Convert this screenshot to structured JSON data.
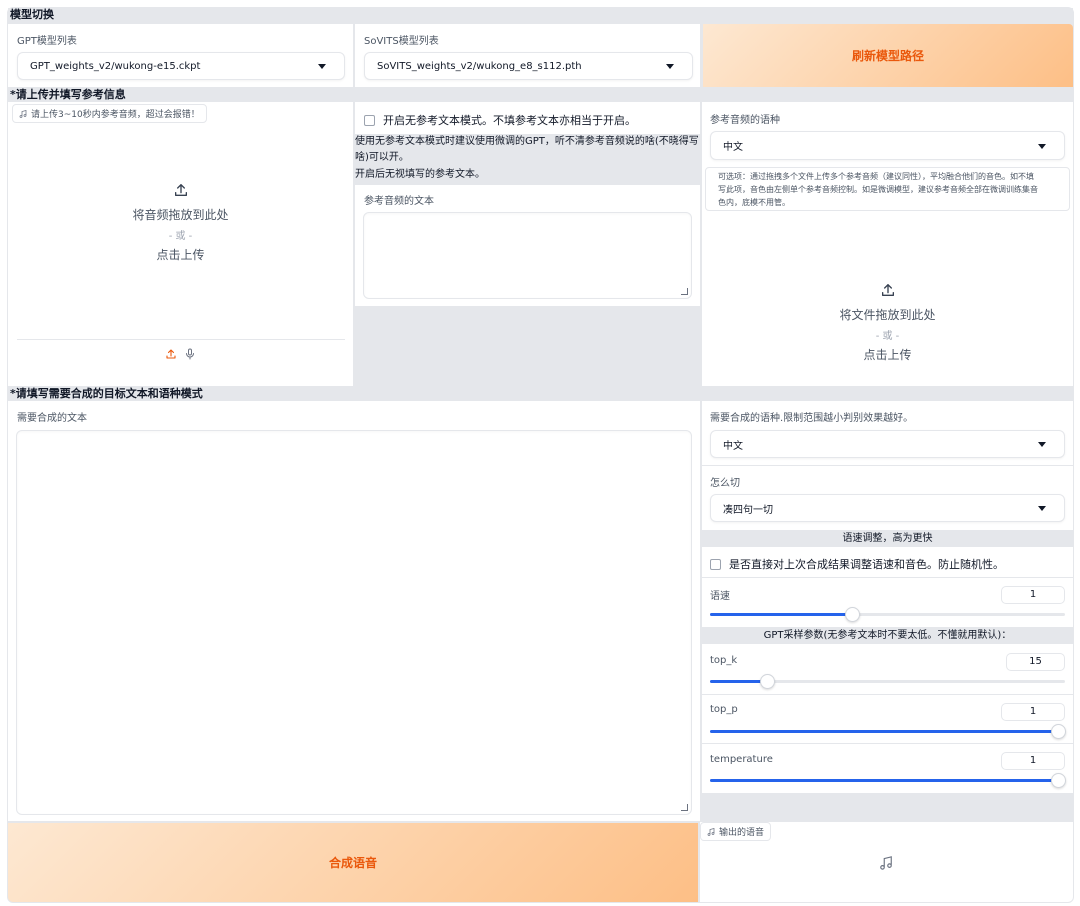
{
  "sections": {
    "model_switch": "模型切换",
    "reference": "*请上传并填写参考信息",
    "target": "*请填写需要合成的目标文本和语种模式"
  },
  "gpt_model": {
    "label": "GPT模型列表",
    "value": "GPT_weights_v2/wukong-e15.ckpt"
  },
  "sovits_model": {
    "label": "SoVITS模型列表",
    "value": "SoVITS_weights_v2/wukong_e8_s112.pth"
  },
  "refresh_button": "刷新模型路径",
  "ref_audio": {
    "chip": "请上传3~10秒内参考音频，超过会报错！",
    "drop_text": "将音频拖放到此处",
    "or_text": "- 或 -",
    "click_text": "点击上传"
  },
  "no_ref": {
    "checkbox_label": "开启无参考文本模式。不填参考文本亦相当于开启。",
    "info_line1": "使用无参考文本模式时建议使用微调的GPT，听不清参考音频说的啥(不晓得写",
    "info_line2": "啥)可以开。",
    "info_line3": "开启后无视填写的参考文本。"
  },
  "ref_text": {
    "label": "参考音频的文本",
    "value": ""
  },
  "ref_lang": {
    "label": "参考音频的语种",
    "value": "中文"
  },
  "multi_ref": {
    "info_line1": "可选项：通过拖拽多个文件上传多个参考音频（建议同性），平均融合他们的音色。如不填",
    "info_line2": "写此项，音色由左侧单个参考音频控制。如是微调模型，建议参考音频全部在微调训练集音",
    "info_line3": "色内，底模不用管。",
    "drop_text": "将文件拖放到此处",
    "or_text": "- 或 -",
    "click_text": "点击上传"
  },
  "target_text": {
    "label": "需要合成的文本",
    "value": ""
  },
  "target_lang": {
    "label": "需要合成的语种.限制范围越小判别效果越好。",
    "value": "中文"
  },
  "cut": {
    "label": "怎么切",
    "value": "凑四句一切"
  },
  "speed_band": "语速调整，高为更快",
  "reuse_checkbox": "是否直接对上次合成结果调整语速和音色。防止随机性。",
  "speed": {
    "label": "语速",
    "value": "1",
    "fraction": 0.4
  },
  "gpt_band": "GPT采样参数(无参考文本时不要太低。不懂就用默认)：",
  "top_k": {
    "label": "top_k",
    "value": "15",
    "fraction": 0.16
  },
  "top_p": {
    "label": "top_p",
    "value": "1",
    "fraction": 1.0
  },
  "temperature": {
    "label": "temperature",
    "value": "1",
    "fraction": 1.0
  },
  "synth_button": "合成语音",
  "output_chip": "输出的语音",
  "colors": {
    "accent": "#ea580c",
    "slider": "#2563eb",
    "band": "#e5e7eb"
  },
  "icons": [
    "upload-icon",
    "microphone-icon",
    "music-note-icon",
    "chevron-down-icon"
  ]
}
